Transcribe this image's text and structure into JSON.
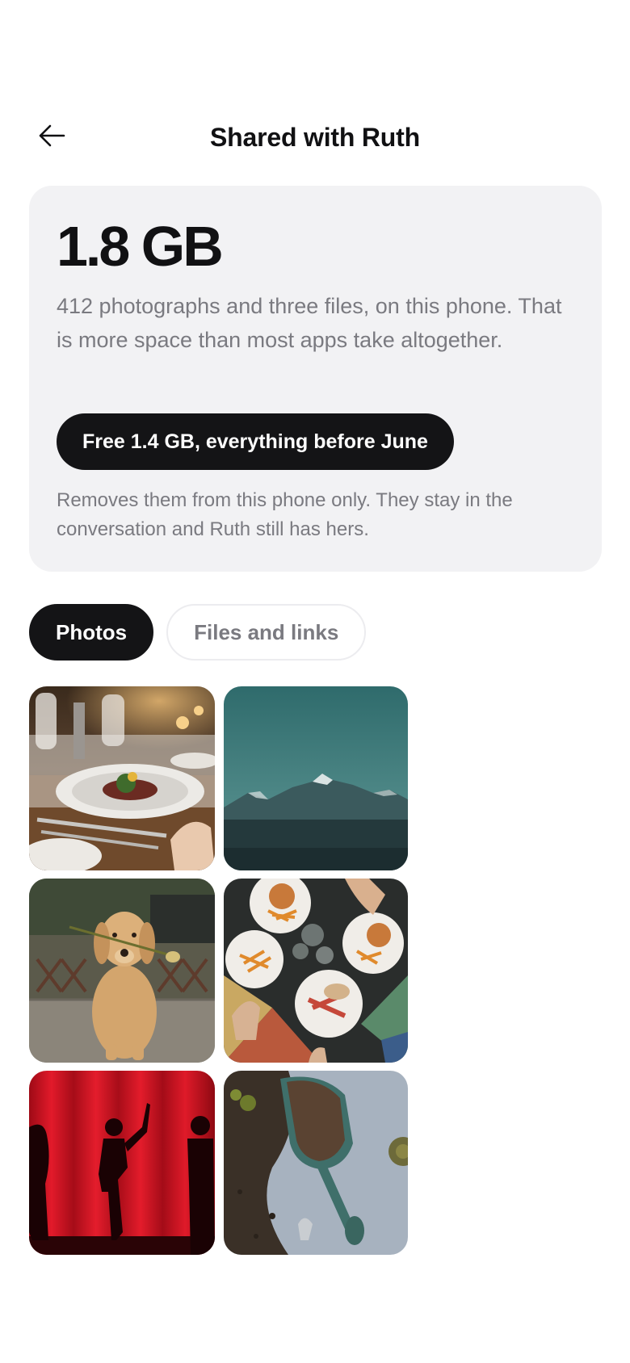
{
  "header": {
    "title": "Shared with Ruth",
    "back_icon": "arrow-left-icon"
  },
  "storage": {
    "size": "1.8 GB",
    "description": "412 photographs and three files, on this phone. That is more space than most apps take altogether.",
    "action_label": "Free 1.4 GB, everything before June",
    "note": "Removes them from this phone only. They stay in the conversation and Ruth still has hers."
  },
  "tabs": [
    {
      "label": "Photos",
      "selected": true
    },
    {
      "label": "Files and links",
      "selected": false
    }
  ],
  "photos": [
    {
      "subject": "restaurant-dinner-table"
    },
    {
      "subject": "mountain-landscape"
    },
    {
      "subject": "golden-retriever-with-flower"
    },
    {
      "subject": "shared-burgers-and-fries"
    },
    {
      "subject": "theatre-silhouettes-red-curtain"
    },
    {
      "subject": "garden-trowel-with-soil"
    }
  ],
  "colors": {
    "primary": "#141416",
    "card_background": "#f2f2f4",
    "muted_text": "#7a7a80"
  }
}
